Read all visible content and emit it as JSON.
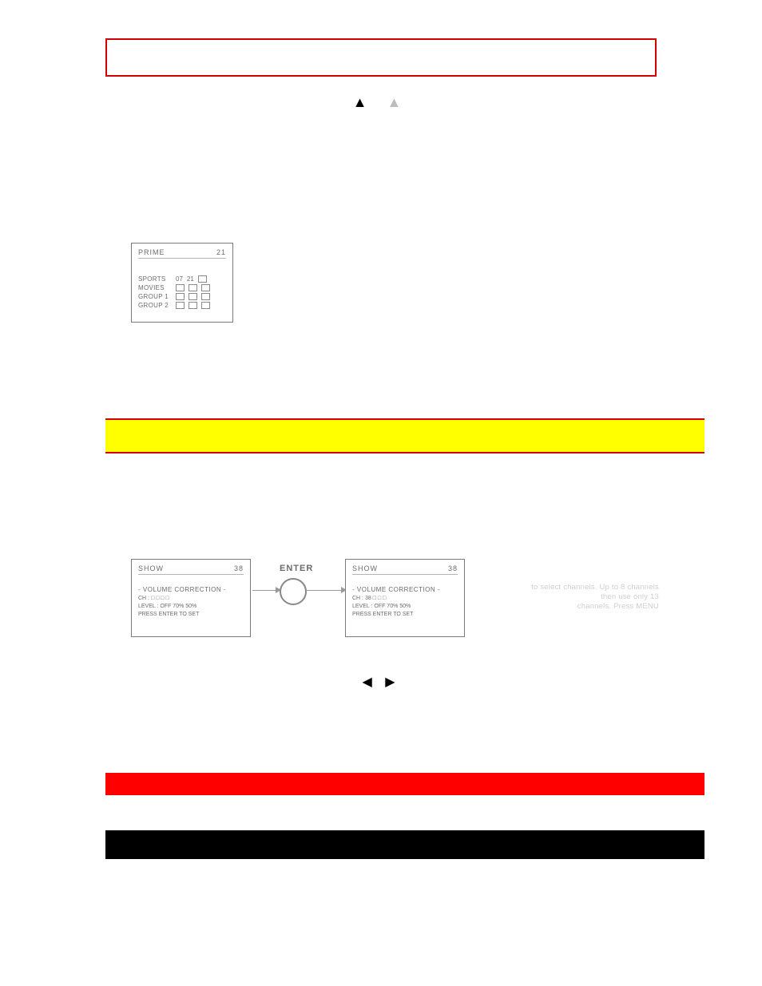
{
  "triangles": {
    "up": "▲",
    "faint": "▲"
  },
  "prime_osd": {
    "title": "PRIME",
    "value": "21",
    "rows": [
      {
        "label": "SPORTS",
        "cells": [
          "07",
          "21",
          ""
        ]
      },
      {
        "label": "MOVIES",
        "cells": [
          "",
          "",
          ""
        ]
      },
      {
        "label": "GROUP 1",
        "cells": [
          "",
          "",
          ""
        ]
      },
      {
        "label": "GROUP 2",
        "cells": [
          "",
          "",
          ""
        ]
      }
    ]
  },
  "flow": {
    "enter_label": "ENTER",
    "left_box": {
      "title": "SHOW",
      "value": "38",
      "vc_title": "- VOLUME CORRECTION -",
      "line_ch": "CH :   □ □ □ □",
      "line_level": "LEVEL : OFF  70%  50%",
      "line_prompt": "PRESS ENTER TO SET"
    },
    "right_box": {
      "title": "SHOW",
      "value": "38",
      "vc_title": "- VOLUME CORRECTION -",
      "line_ch": "CH :  38  □ □ □",
      "line_level": "LEVEL : OFF  70%  50%",
      "line_prompt": "PRESS ENTER TO SET"
    }
  },
  "ghost": {
    "g1": "to select channels. Up to 8 channels",
    "g2": "then use only 13",
    "g3": "channels. Press MENU"
  },
  "lr": {
    "left": "◀",
    "right": "▶"
  }
}
